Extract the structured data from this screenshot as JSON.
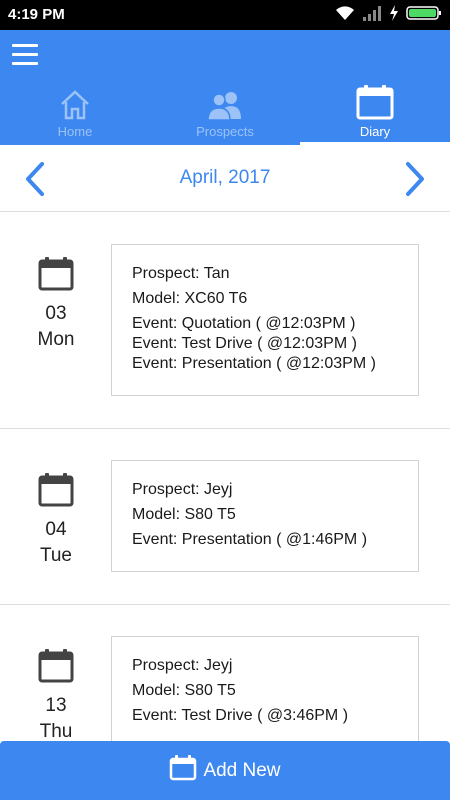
{
  "status_bar": {
    "time": "4:19 PM",
    "icons": [
      "wifi-icon",
      "signal-icon",
      "charging-icon",
      "battery-icon"
    ]
  },
  "header": {
    "menu_icon": "hamburger-menu-icon",
    "tabs": [
      {
        "label": "Home",
        "icon": "home-icon",
        "active": false
      },
      {
        "label": "Prospects",
        "icon": "people-icon",
        "active": false
      },
      {
        "label": "Diary",
        "icon": "calendar-icon",
        "active": true
      }
    ]
  },
  "month_nav": {
    "title": "April, 2017",
    "prev_icon": "chevron-left-icon",
    "next_icon": "chevron-right-icon"
  },
  "diary": [
    {
      "day_num": "03",
      "day_name": "Mon",
      "prospect": "Prospect: Tan",
      "model": "Model: XC60 T6",
      "events": [
        "Event: Quotation ( @12:03PM )",
        "Event: Test Drive ( @12:03PM )",
        "Event: Presentation ( @12:03PM )"
      ]
    },
    {
      "day_num": "04",
      "day_name": "Tue",
      "prospect": "Prospect: Jeyj",
      "model": "Model: S80 T5",
      "events": [
        "Event: Presentation ( @1:46PM )"
      ]
    },
    {
      "day_num": "13",
      "day_name": "Thu",
      "prospect": "Prospect: Jeyj",
      "model": "Model: S80 T5",
      "events": [
        "Event: Test Drive ( @3:46PM )"
      ]
    }
  ],
  "footer": {
    "add_new_label": "Add New",
    "add_new_icon": "calendar-icon"
  },
  "colors": {
    "primary": "#3d87f0",
    "inactive_tab": "#9cc2f7",
    "status_bar": "#000000",
    "battery": "#4cd964"
  }
}
